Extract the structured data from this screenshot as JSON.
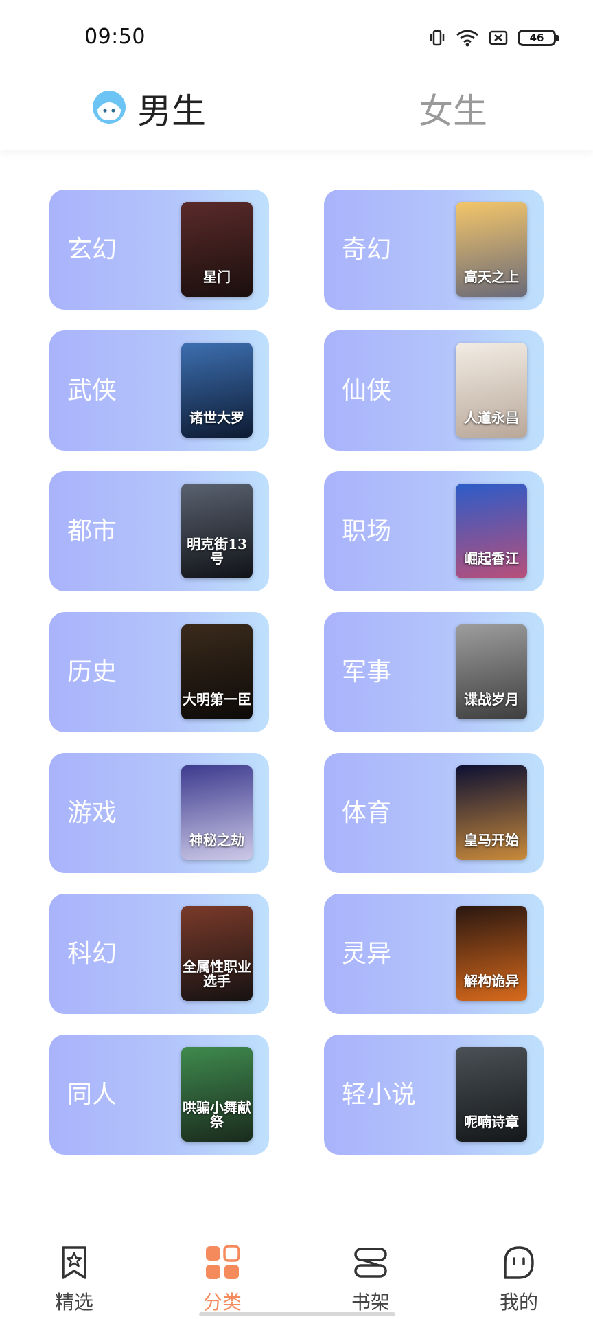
{
  "status": {
    "time": "09:50",
    "battery": "46"
  },
  "gender_tabs": {
    "male": "男生",
    "female": "女生",
    "active": "male"
  },
  "categories": [
    {
      "label": "玄幻",
      "cover_text": "星门",
      "cover_colors": [
        "#5a2a2a",
        "#1a0f0d"
      ]
    },
    {
      "label": "奇幻",
      "cover_text": "高天之上",
      "cover_colors": [
        "#f4c66a",
        "#6a6a78"
      ]
    },
    {
      "label": "武侠",
      "cover_text": "诸世大罗",
      "cover_colors": [
        "#3d6fb0",
        "#0d1b33"
      ]
    },
    {
      "label": "仙侠",
      "cover_text": "人道永昌",
      "cover_colors": [
        "#f2ece4",
        "#b9a89a"
      ]
    },
    {
      "label": "都市",
      "cover_text": "明克街13号",
      "cover_colors": [
        "#5a6270",
        "#111318"
      ]
    },
    {
      "label": "职场",
      "cover_text": "崛起香江",
      "cover_colors": [
        "#2c5cc8",
        "#b84f7a"
      ]
    },
    {
      "label": "历史",
      "cover_text": "大明第一臣",
      "cover_colors": [
        "#3a2a1c",
        "#0d0a08"
      ]
    },
    {
      "label": "军事",
      "cover_text": "谍战岁月",
      "cover_colors": [
        "#9d9d9d",
        "#3e3e3e"
      ]
    },
    {
      "label": "游戏",
      "cover_text": "神秘之劫",
      "cover_colors": [
        "#3d3b8e",
        "#cdc9e8"
      ]
    },
    {
      "label": "体育",
      "cover_text": "皇马开始",
      "cover_colors": [
        "#0c1033",
        "#c98a3a"
      ]
    },
    {
      "label": "科幻",
      "cover_text": "全属性职业选手",
      "cover_colors": [
        "#7a3a2a",
        "#161212"
      ]
    },
    {
      "label": "灵异",
      "cover_text": "解构诡异",
      "cover_colors": [
        "#2a1710",
        "#d86a1c"
      ]
    },
    {
      "label": "同人",
      "cover_text": "哄骗小舞献祭",
      "cover_colors": [
        "#3f8a4e",
        "#1a2b1d"
      ]
    },
    {
      "label": "轻小说",
      "cover_text": "呢喃诗章",
      "cover_colors": [
        "#4a5055",
        "#15181a"
      ]
    }
  ],
  "bottom_nav": {
    "items": [
      {
        "label": "精选",
        "icon": "star-bookmark-icon",
        "active": false
      },
      {
        "label": "分类",
        "icon": "grid-category-icon",
        "active": true
      },
      {
        "label": "书架",
        "icon": "bookshelf-icon",
        "active": false
      },
      {
        "label": "我的",
        "icon": "profile-face-icon",
        "active": false
      }
    ]
  },
  "colors": {
    "accent": "#f58a5c",
    "card_start": "#a9b3fb",
    "card_end": "#bfe0fd",
    "avatar": "#6cc4f5"
  }
}
